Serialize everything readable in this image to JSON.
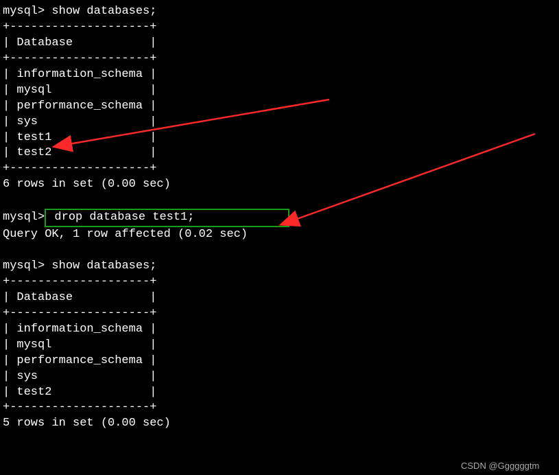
{
  "term": {
    "prompt": "mysql>",
    "cmd_show": "show databases;",
    "table_sep": "+--------------------+",
    "col_header": "| Database           |",
    "rows_before": [
      "| information_schema |",
      "| mysql              |",
      "| performance_schema |",
      "| sys                |",
      "| test1              |",
      "| test2              |"
    ],
    "summary_before": "6 rows in set (0.00 sec)",
    "cmd_drop": "drop database test1;",
    "drop_result": "Query OK, 1 row affected (0.02 sec)",
    "rows_after": [
      "| information_schema |",
      "| mysql              |",
      "| performance_schema |",
      "| sys                |",
      "| test2              |"
    ],
    "summary_after": "5 rows in set (0.00 sec)"
  },
  "watermark": "CSDN @Ggggggtm"
}
